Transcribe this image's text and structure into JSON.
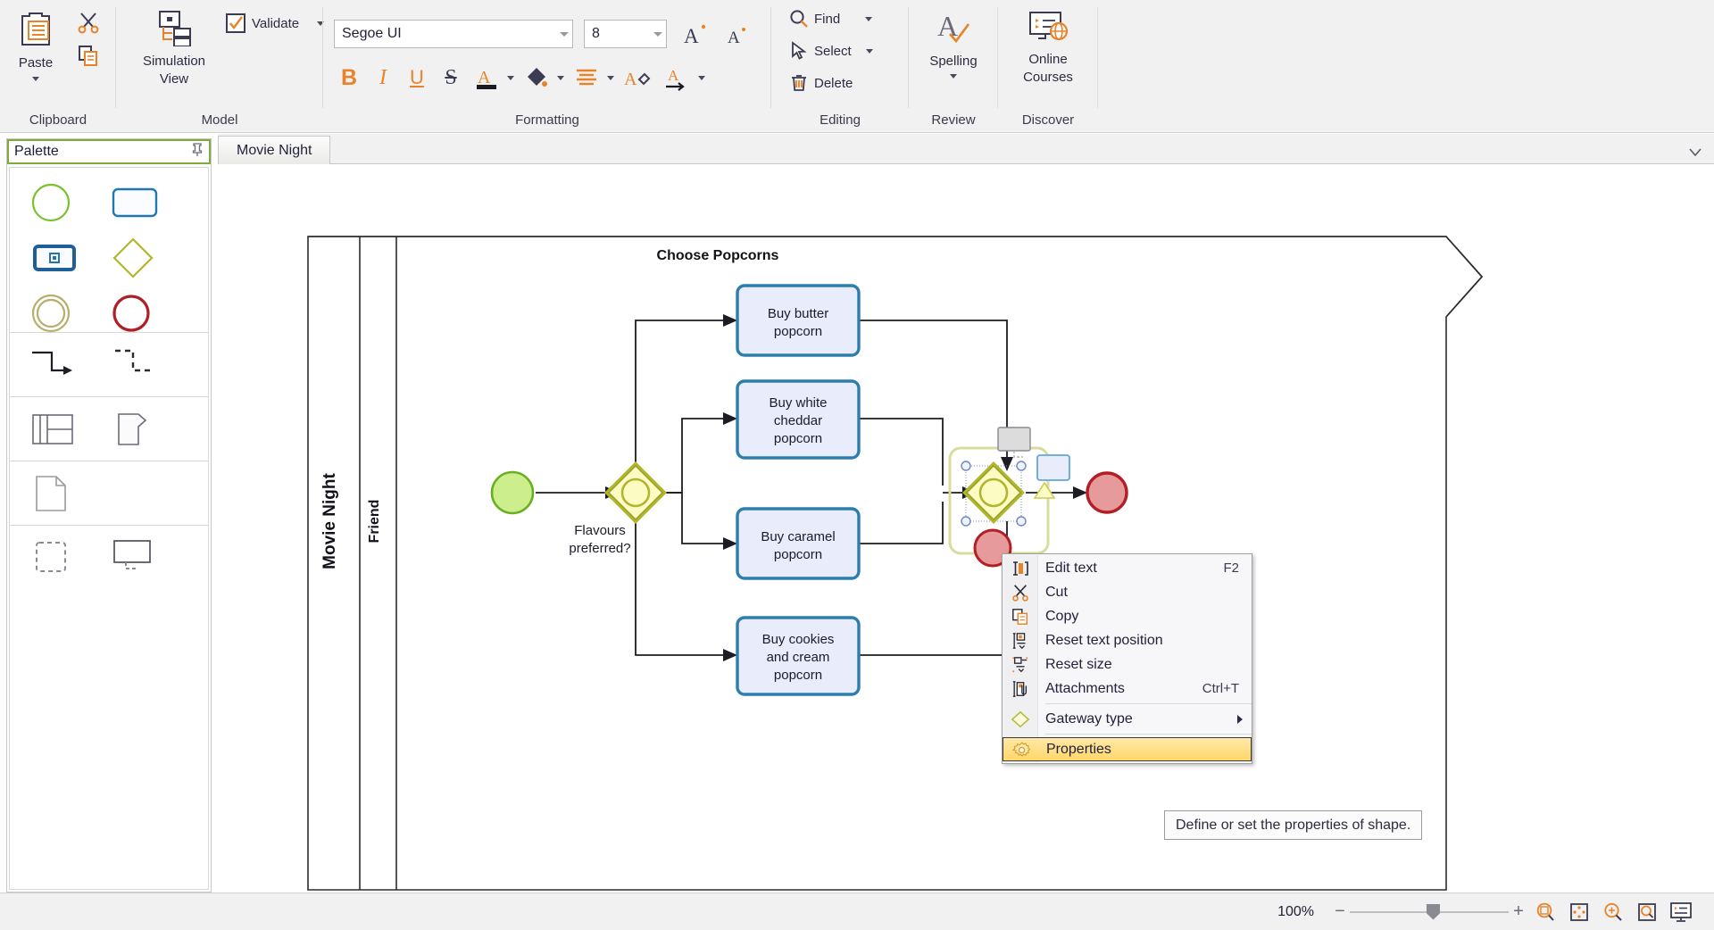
{
  "ribbon": {
    "groups": [
      {
        "name": "Clipboard",
        "label": "Clipboard"
      },
      {
        "name": "Model",
        "label": "Model"
      },
      {
        "name": "Formatting",
        "label": "Formatting"
      },
      {
        "name": "Editing",
        "label": "Editing"
      },
      {
        "name": "Review",
        "label": "Review"
      },
      {
        "name": "Discover",
        "label": "Discover"
      }
    ],
    "clipboard": {
      "paste_label": "Paste",
      "paste_icon": "clipboard-paste-icon",
      "cut_icon": "scissors-icon",
      "copy_icon": "copy-icon"
    },
    "model": {
      "simulation_view_label": "Simulation View",
      "simulation_icon": "simulation-tree-icon",
      "validate_label": "Validate",
      "validate_icon": "checkbox-check-icon"
    },
    "formatting": {
      "font_family_value": "Segoe UI",
      "font_size_value": "8",
      "grow_font_icon": "grow-font-icon",
      "shrink_font_icon": "shrink-font-icon",
      "bold_label": "B",
      "italic_label": "I",
      "underline_label": "U",
      "strikethrough_label": "S",
      "font_color_label": "A",
      "fill_color_icon": "paint-bucket-icon",
      "align_icon": "align-lines-icon",
      "format_painter_icon": "format-painter-icon",
      "text_direction_label": "A"
    },
    "editing": {
      "find_label": "Find",
      "find_icon": "search-icon",
      "select_label": "Select",
      "select_icon": "cursor-arrow-icon",
      "delete_label": "Delete",
      "delete_icon": "trash-icon"
    },
    "review": {
      "spelling_label": "Spelling",
      "spelling_icon": "spelling-check-icon"
    },
    "discover": {
      "online_courses_label": "Online Courses",
      "online_courses_icon": "monitor-globe-icon"
    }
  },
  "palette": {
    "title": "Palette",
    "pin_icon": "pin-icon",
    "sections": [
      {
        "name": "events-activities",
        "items": [
          {
            "name": "start-event-shape",
            "icon": "green-circle-icon"
          },
          {
            "name": "task-shape",
            "icon": "rounded-rect-icon"
          },
          {
            "name": "subprocess-shape",
            "icon": "subprocess-rect-icon"
          },
          {
            "name": "gateway-shape",
            "icon": "diamond-icon"
          },
          {
            "name": "intermediate-event-shape",
            "icon": "double-circle-icon"
          },
          {
            "name": "end-event-shape",
            "icon": "red-circle-icon"
          }
        ]
      },
      {
        "name": "connectors",
        "items": [
          {
            "name": "sequence-flow-connector",
            "icon": "solid-elbow-arrow-icon"
          },
          {
            "name": "message-flow-connector",
            "icon": "dashed-elbow-arrow-icon"
          }
        ]
      },
      {
        "name": "containers",
        "items": [
          {
            "name": "pool-shape",
            "icon": "pool-grid-icon"
          },
          {
            "name": "data-object-shape",
            "icon": "data-object-icon"
          }
        ]
      },
      {
        "name": "artifacts",
        "items": [
          {
            "name": "document-shape",
            "icon": "page-corner-icon"
          }
        ]
      },
      {
        "name": "annotations",
        "items": [
          {
            "name": "group-shape",
            "icon": "dashed-square-icon"
          },
          {
            "name": "text-annotation-shape",
            "icon": "callout-box-icon"
          }
        ]
      }
    ]
  },
  "tabs": {
    "items": [
      {
        "label": "Movie Night",
        "active": true
      }
    ],
    "dropdown_icon": "chevron-down-icon"
  },
  "diagram": {
    "pool_label": "Movie Night",
    "lane_label": "Friend",
    "title": "Choose Popcorns",
    "start_event": {
      "name": "start-event",
      "label": ""
    },
    "gateway_1": {
      "name": "gateway-flavours",
      "label": "Flavours preferred?"
    },
    "tasks": [
      {
        "name": "task-buy-butter",
        "label": "Buy butter popcorn"
      },
      {
        "name": "task-buy-white-cheddar",
        "label": "Buy white cheddar popcorn"
      },
      {
        "name": "task-buy-caramel",
        "label": "Buy caramel popcorn"
      },
      {
        "name": "task-buy-cookies-cream",
        "label": "Buy cookies and cream popcorn"
      }
    ],
    "gateway_2": {
      "name": "gateway-merge",
      "label": ""
    },
    "end_event": {
      "name": "end-event",
      "label": ""
    },
    "quick_shapes": [
      {
        "name": "quick-shape-task-gray",
        "icon": "gray-rect-icon"
      },
      {
        "name": "quick-shape-task-blue",
        "icon": "blue-rect-icon"
      },
      {
        "name": "quick-shape-gateway",
        "icon": "yellow-triangle-icon"
      },
      {
        "name": "quick-shape-end-event",
        "icon": "red-circle-icon"
      }
    ],
    "colors": {
      "start_fill": "#cdee8d",
      "start_stroke": "#6ab023",
      "gateway_fill": "#fdfbc4",
      "gateway_stroke": "#b2b52e",
      "task_fill": "#e8ecfb",
      "task_stroke": "#2e7ead",
      "end_fill": "#e79a9c",
      "end_stroke": "#b21f24"
    }
  },
  "context_menu": {
    "items": [
      {
        "label": "Edit text",
        "shortcut": "F2",
        "icon": "edit-text-icon",
        "name": "menu-item-edit-text",
        "selected": false,
        "submenu": false
      },
      {
        "label": "Cut",
        "shortcut": "",
        "icon": "scissors-icon",
        "name": "menu-item-cut",
        "selected": false,
        "submenu": false
      },
      {
        "label": "Copy",
        "shortcut": "",
        "icon": "copy-icon",
        "name": "menu-item-copy",
        "selected": false,
        "submenu": false
      },
      {
        "label": "Reset text position",
        "shortcut": "",
        "icon": "reset-text-position-icon",
        "name": "menu-item-reset-text-position",
        "selected": false,
        "submenu": false
      },
      {
        "label": "Reset size",
        "shortcut": "",
        "icon": "reset-size-icon",
        "name": "menu-item-reset-size",
        "selected": false,
        "submenu": false
      },
      {
        "label": "Attachments",
        "shortcut": "Ctrl+T",
        "icon": "attachment-icon",
        "name": "menu-item-attachments",
        "selected": false,
        "submenu": false
      },
      {
        "label": "Gateway type",
        "shortcut": "",
        "icon": "diamond-icon",
        "name": "menu-item-gateway-type",
        "selected": false,
        "submenu": true
      },
      {
        "label": "Properties",
        "shortcut": "",
        "icon": "gear-icon",
        "name": "menu-item-properties",
        "selected": true,
        "submenu": false
      }
    ],
    "separator_after": [
      5,
      6
    ]
  },
  "tooltip": {
    "text": "Define or set the properties of shape."
  },
  "statusbar": {
    "zoom_label": "100%",
    "zoom_out_label": "−",
    "zoom_in_label": "+",
    "buttons": [
      {
        "name": "zoom-to-selection-button",
        "icon": "magnifier-square-icon"
      },
      {
        "name": "fit-page-button",
        "icon": "fit-page-icon"
      },
      {
        "name": "zoom-in-button",
        "icon": "magnifier-plus-icon"
      },
      {
        "name": "zoom-to-fit-button",
        "icon": "magnifier-boxed-icon"
      },
      {
        "name": "presentation-mode-button",
        "icon": "presentation-icon"
      }
    ]
  },
  "theme": {
    "accent": "#e8832a",
    "dark": "#3b3b52",
    "ribbon_bg": "#f1f1f1",
    "highlight": "#ffd76a"
  }
}
